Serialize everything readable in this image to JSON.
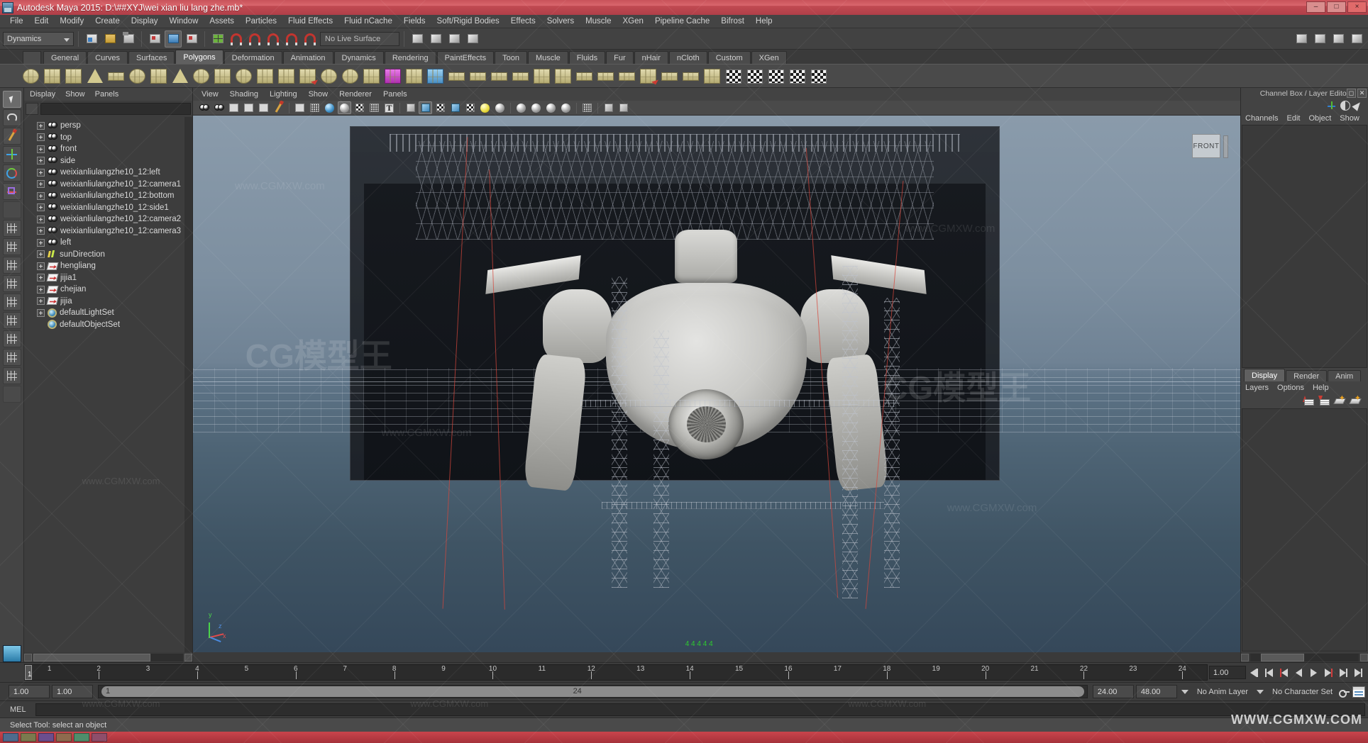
{
  "window": {
    "title": "Autodesk Maya 2015: D:\\##XYJ\\wei xian liu lang zhe.mb*",
    "minimize": "–",
    "maximize": "□",
    "close": "×"
  },
  "menubar": {
    "items": [
      "File",
      "Edit",
      "Modify",
      "Create",
      "Display",
      "Window",
      "Assets",
      "Particles",
      "Fluid Effects",
      "Fluid nCache",
      "Fields",
      "Soft/Rigid Bodies",
      "Effects",
      "Solvers",
      "Muscle",
      "XGen",
      "Pipeline Cache",
      "Bifrost",
      "Help"
    ]
  },
  "statusbar": {
    "menu_set": "Dynamics",
    "live_surface": "No Live Surface"
  },
  "shelf": {
    "tabs": [
      "General",
      "Curves",
      "Surfaces",
      "Polygons",
      "Deformation",
      "Animation",
      "Dynamics",
      "Rendering",
      "PaintEffects",
      "Toon",
      "Muscle",
      "Fluids",
      "Fur",
      "nHair",
      "nCloth",
      "Custom",
      "XGen"
    ],
    "active_tab": "Polygons"
  },
  "outliner": {
    "menus": [
      "Display",
      "Show",
      "Panels"
    ],
    "search_value": "",
    "items": [
      {
        "label": "persp",
        "icon": "camera-icon"
      },
      {
        "label": "top",
        "icon": "camera-icon"
      },
      {
        "label": "front",
        "icon": "camera-icon"
      },
      {
        "label": "side",
        "icon": "camera-icon"
      },
      {
        "label": "weixianliulangzhe10_12:left",
        "icon": "camera-icon"
      },
      {
        "label": "weixianliulangzhe10_12:camera1",
        "icon": "camera-icon"
      },
      {
        "label": "weixianliulangzhe10_12:bottom",
        "icon": "camera-icon"
      },
      {
        "label": "weixianliulangzhe10_12:side1",
        "icon": "camera-icon"
      },
      {
        "label": "weixianliulangzhe10_12:camera2",
        "icon": "camera-icon"
      },
      {
        "label": "weixianliulangzhe10_12:camera3",
        "icon": "camera-icon"
      },
      {
        "label": "left",
        "icon": "camera-icon"
      },
      {
        "label": "sunDirection",
        "icon": "sun-icon"
      },
      {
        "label": "hengliang",
        "icon": "transform-icon"
      },
      {
        "label": "jijia1",
        "icon": "transform-icon"
      },
      {
        "label": "chejian",
        "icon": "transform-icon"
      },
      {
        "label": "jijia",
        "icon": "transform-icon"
      },
      {
        "label": "defaultLightSet",
        "icon": "set-icon"
      },
      {
        "label": "defaultObjectSet",
        "icon": "set-icon",
        "no_expand": true
      }
    ]
  },
  "viewport": {
    "menus": [
      "View",
      "Shading",
      "Lighting",
      "Show",
      "Renderer",
      "Panels"
    ],
    "view_gizmo_label": "FRONT",
    "axis_labels": {
      "x": "x",
      "y": "y",
      "z": "z"
    },
    "hud_text": "4 4 4 4 4"
  },
  "channelbox": {
    "title": "Channel Box / Layer Editor",
    "menus": [
      "Channels",
      "Edit",
      "Object",
      "Show"
    ],
    "layer_tabs": [
      "Display",
      "Render",
      "Anim"
    ],
    "layer_active_tab": "Display",
    "layer_menus": [
      "Layers",
      "Options",
      "Help"
    ]
  },
  "timeline": {
    "ticks": [
      1,
      2,
      3,
      4,
      5,
      6,
      7,
      8,
      9,
      10,
      11,
      12,
      13,
      14,
      15,
      16,
      17,
      18,
      19,
      20,
      21,
      22,
      23,
      24
    ],
    "current_frame": "1",
    "current_frame_field": "1.00"
  },
  "range": {
    "start": "1.00",
    "start2": "1.00",
    "slider_start_label": "1",
    "slider_end_label": "24",
    "end": "24.00",
    "playback_end": "48.00",
    "anim_layer": "No Anim Layer",
    "character_set": "No Character Set"
  },
  "command_line": {
    "label": "MEL",
    "value": ""
  },
  "help_line": {
    "text": "Select Tool: select an object"
  },
  "watermarks": {
    "site": "www.CGMXW.com",
    "logo_text": "CG模型王",
    "brand": "WWW.CGMXW.COM"
  },
  "colors": {
    "titlebar": "#c9535a",
    "panel_bg": "#434343",
    "accent_red": "#cc3b33",
    "text": "#d2d2d2",
    "viewport_sky": "#8a9bab"
  }
}
